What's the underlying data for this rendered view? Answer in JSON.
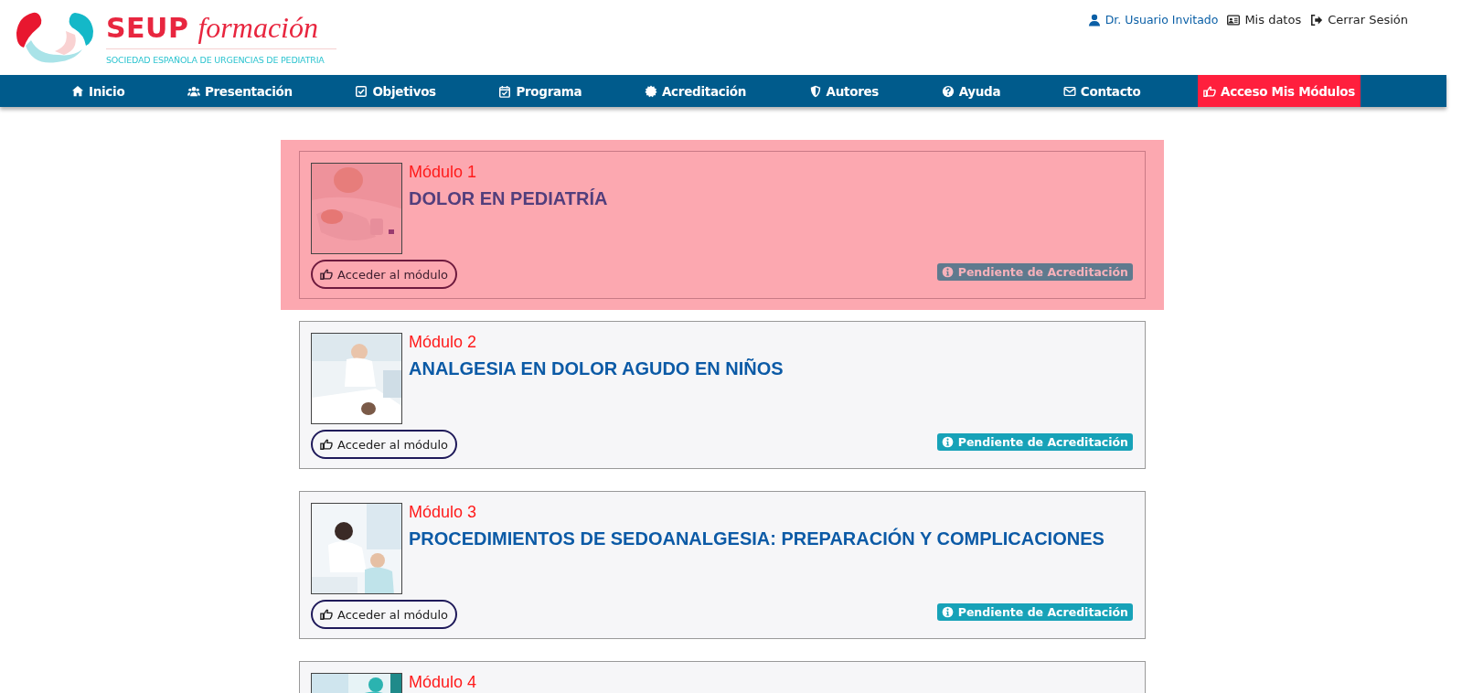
{
  "header": {
    "logo": {
      "brand": "SEUP",
      "subtitle": "formación",
      "tagline": "SOCIEDAD ESPAÑOLA DE URGENCIAS DE PEDIATRIA"
    },
    "user_links": [
      {
        "kind": "user",
        "label": "Dr. Usuario Invitado"
      },
      {
        "kind": "data",
        "label": "Mis datos"
      },
      {
        "kind": "logout",
        "label": "Cerrar Sesión"
      }
    ]
  },
  "nav": [
    {
      "label": "Inicio",
      "selected": false
    },
    {
      "label": "Presentación",
      "selected": false
    },
    {
      "label": "Objetivos",
      "selected": false
    },
    {
      "label": "Programa",
      "selected": false
    },
    {
      "label": "Acreditación",
      "selected": false
    },
    {
      "label": "Autores",
      "selected": false
    },
    {
      "label": "Ayuda",
      "selected": false
    },
    {
      "label": "Contacto",
      "selected": false
    },
    {
      "label": "Acceso Mis Módulos",
      "selected": true
    }
  ],
  "modules": [
    {
      "label": "Módulo 1",
      "title": "DOLOR EN PEDIATRÍA",
      "button": "Acceder al módulo",
      "status": "Pendiente de Acreditación",
      "selected": true
    },
    {
      "label": "Módulo 2",
      "title": "ANALGESIA EN DOLOR AGUDO EN NIÑOS",
      "button": "Acceder al módulo",
      "status": "Pendiente de Acreditación",
      "selected": false
    },
    {
      "label": "Módulo 3",
      "title": "PROCEDIMIENTOS DE SEDOANALGESIA: PREPARACIÓN Y COMPLICACIONES",
      "button": "Acceder al módulo",
      "status": "Pendiente de Acreditación",
      "selected": false
    },
    {
      "label": "Módulo 4",
      "selected": false
    }
  ]
}
